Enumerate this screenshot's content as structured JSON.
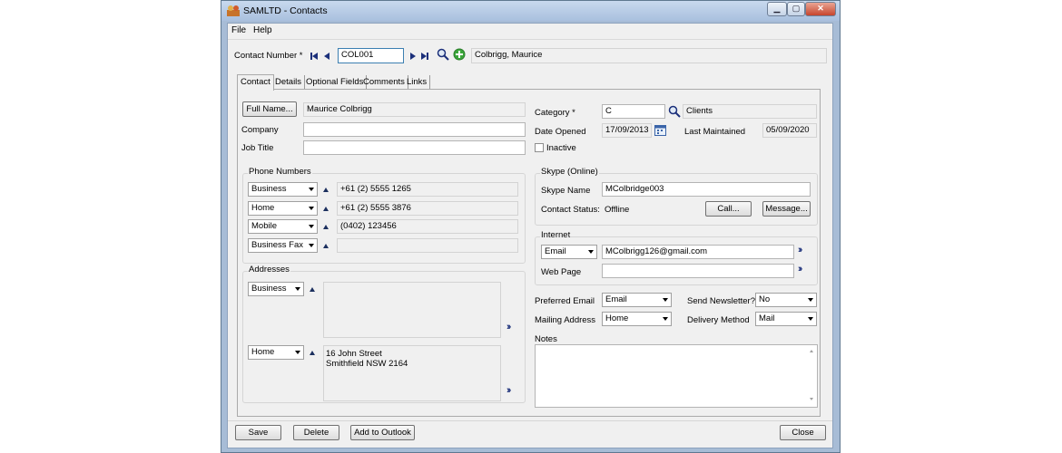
{
  "window": {
    "title": "SAMLTD - Contacts",
    "minimize_glyph": "▁",
    "maximize_glyph": "▢",
    "close_glyph": "✕"
  },
  "menu": [
    "File",
    "Help"
  ],
  "header": {
    "contact_number_label": "Contact Number *",
    "contact_number_value": "COL001",
    "contact_name": "Colbrigg, Maurice"
  },
  "tabs": [
    "Contact",
    "Details",
    "Optional Fields",
    "Comments",
    "Links"
  ],
  "contact": {
    "full_name_button": "Full Name...",
    "full_name_value": "Maurice Colbrigg",
    "company_label": "Company",
    "company_value": "",
    "job_title_label": "Job Title",
    "job_title_value": ""
  },
  "phone_numbers": {
    "title": "Phone Numbers",
    "rows": [
      {
        "type": "Business",
        "value": "+61 (2) 5555 1265"
      },
      {
        "type": "Home",
        "value": "+61 (2) 5555 3876"
      },
      {
        "type": "Mobile",
        "value": "(0402) 123456"
      },
      {
        "type": "Business Fax",
        "value": ""
      }
    ]
  },
  "addresses": {
    "title": "Addresses",
    "rows": [
      {
        "type": "Business",
        "line1": "",
        "line2": ""
      },
      {
        "type": "Home",
        "line1": "16 John Street",
        "line2": "Smithfield NSW 2164"
      }
    ]
  },
  "category": {
    "label": "Category *",
    "code": "C",
    "description": "Clients",
    "date_opened_label": "Date Opened",
    "date_opened_value": "17/09/2013",
    "last_maintained_label": "Last Maintained",
    "last_maintained_value": "05/09/2020",
    "inactive_label": "Inactive"
  },
  "skype": {
    "title": "Skype (Online)",
    "name_label": "Skype Name",
    "name_value": "MColbridge003",
    "status_label": "Contact Status:",
    "status_value": "Offline",
    "call_button": "Call...",
    "message_button": "Message..."
  },
  "internet": {
    "title": "Internet",
    "email_type": "Email",
    "email_value": "MColbrigg126@gmail.com",
    "web_page_label": "Web Page",
    "web_page_value": ""
  },
  "preferences": {
    "preferred_email_label": "Preferred Email",
    "preferred_email_value": "Email",
    "send_newsletter_label": "Send Newsletter?",
    "send_newsletter_value": "No",
    "mailing_address_label": "Mailing Address",
    "mailing_address_value": "Home",
    "delivery_method_label": "Delivery Method",
    "delivery_method_value": "Mail"
  },
  "notes": {
    "label": "Notes",
    "value": ""
  },
  "footer": {
    "save": "Save",
    "delete": "Delete",
    "add_to_outlook": "Add to Outlook",
    "close": "Close"
  },
  "colors": {
    "window_frame": "#a7bcd6",
    "nav_arrow": "#1b2f7a",
    "add_icon": "#3aa63a"
  }
}
